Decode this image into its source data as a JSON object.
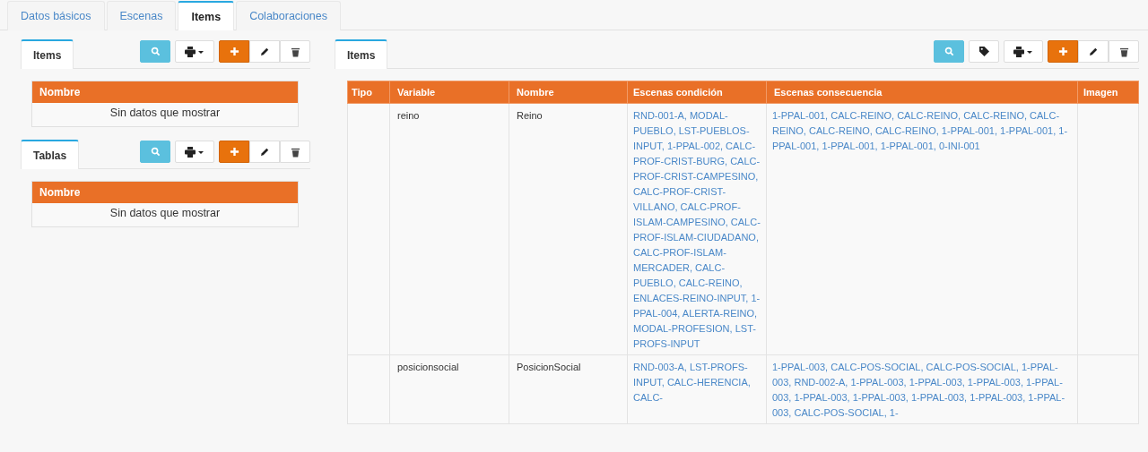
{
  "tabs": [
    {
      "label": "Datos básicos",
      "selected": false
    },
    {
      "label": "Escenas",
      "selected": false
    },
    {
      "label": "Items",
      "selected": true
    },
    {
      "label": "Colaboraciones",
      "selected": false
    }
  ],
  "left_panels": [
    {
      "tab": {
        "label": "Items",
        "selected": true
      },
      "toolbar": [
        {
          "kind": "search"
        },
        {
          "kind": "print"
        },
        {
          "kind": "add"
        },
        {
          "kind": "edit"
        },
        {
          "kind": "delete"
        }
      ],
      "table": {
        "columns": [
          "Nombre"
        ],
        "empty_message": "Sin datos que mostrar"
      }
    },
    {
      "tab": {
        "label": "Tablas",
        "selected": true
      },
      "toolbar": [
        {
          "kind": "search"
        },
        {
          "kind": "print"
        },
        {
          "kind": "add"
        },
        {
          "kind": "edit"
        },
        {
          "kind": "delete"
        }
      ],
      "table": {
        "columns": [
          "Nombre"
        ],
        "empty_message": "Sin datos que mostrar"
      }
    }
  ],
  "right_panel": {
    "tab": {
      "label": "Items",
      "selected": true
    },
    "toolbar": [
      {
        "kind": "search"
      },
      {
        "kind": "tag"
      },
      {
        "kind": "print"
      },
      {
        "kind": "add"
      },
      {
        "kind": "edit"
      },
      {
        "kind": "delete"
      }
    ],
    "table": {
      "columns": [
        "Tipo",
        "Variable",
        "Nombre",
        "Escenas condición",
        "Escenas consecuencia",
        "Imagen"
      ],
      "rows": [
        {
          "variable": "reino",
          "nombre": "Reino",
          "escenas_condicion": "RND-001-A, MODAL-PUEBLO, LST-PUEBLOS-INPUT, 1-PPAL-002, CALC-PROF-CRIST-BURG, CALC-PROF-CRIST-CAMPESINO, CALC-PROF-CRIST-VILLANO, CALC-PROF-ISLAM-CAMPESINO, CALC-PROF-ISLAM-CIUDADANO, CALC-PROF-ISLAM-MERCADER, CALC-PUEBLO, CALC-REINO, ENLACES-REINO-INPUT, 1-PPAL-004, ALERTA-REINO, MODAL-PROFESION, LST-PROFS-INPUT",
          "escenas_consecuencia": "1-PPAL-001, CALC-REINO, CALC-REINO, CALC-REINO, CALC-REINO, CALC-REINO, CALC-REINO, 1-PPAL-001, 1-PPAL-001, 1-PPAL-001, 1-PPAL-001, 1-PPAL-001, 0-INI-001"
        },
        {
          "variable": "posicionsocial",
          "nombre": "PosicionSocial",
          "escenas_condicion": "RND-003-A, LST-PROFS-INPUT, CALC-HERENCIA, CALC-",
          "escenas_consecuencia": "1-PPAL-003, CALC-POS-SOCIAL, CALC-POS-SOCIAL, 1-PPAL-003, RND-002-A, 1-PPAL-003, 1-PPAL-003, 1-PPAL-003, 1-PPAL-003, 1-PPAL-003, 1-PPAL-003, 1-PPAL-003, 1-PPAL-003, 1-PPAL-003, CALC-POS-SOCIAL, 1-"
        }
      ]
    }
  }
}
